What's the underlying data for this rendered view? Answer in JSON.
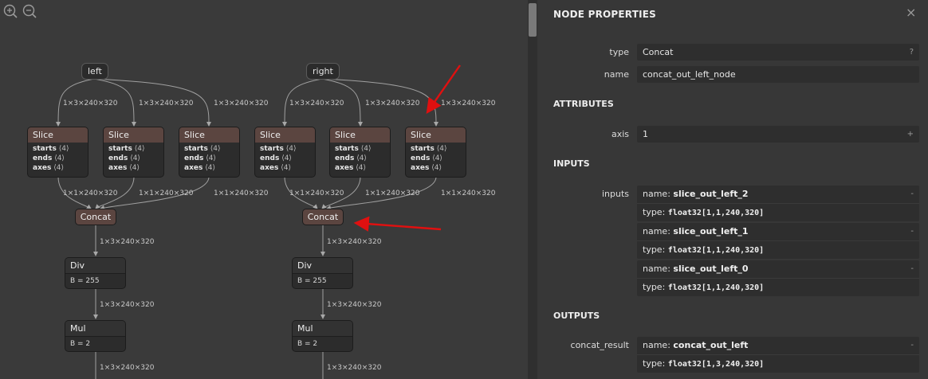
{
  "graph": {
    "edge_labels": {
      "rgb": "1×3×240×320",
      "channel": "1×1×240×320"
    },
    "inputs": {
      "left": "left",
      "right": "right"
    },
    "slice": {
      "title": "Slice",
      "attrs": [
        {
          "name": "starts",
          "value": "⟨4⟩"
        },
        {
          "name": "ends",
          "value": "⟨4⟩"
        },
        {
          "name": "axes",
          "value": "⟨4⟩"
        }
      ]
    },
    "concat_title": "Concat",
    "div": {
      "title": "Div",
      "attr": "B = 255"
    },
    "mul": {
      "title": "Mul",
      "attr": "B = 2"
    }
  },
  "panel": {
    "title": "NODE PROPERTIES",
    "close_icon": "×",
    "type_label": "type",
    "type_value": "Concat",
    "type_help": "?",
    "name_label": "name",
    "name_value": "concat_out_left_node",
    "attributes_header": "ATTRIBUTES",
    "axis_label": "axis",
    "axis_value": "1",
    "axis_btn": "+",
    "inputs_header": "INPUTS",
    "inputs_label": "inputs",
    "inputs": [
      {
        "name_prefix": "name: ",
        "name": "slice_out_left_2",
        "type_prefix": "type: ",
        "type": "float32[1,1,240,320]",
        "btn": "-"
      },
      {
        "name_prefix": "name: ",
        "name": "slice_out_left_1",
        "type_prefix": "type: ",
        "type": "float32[1,1,240,320]",
        "btn": "-"
      },
      {
        "name_prefix": "name: ",
        "name": "slice_out_left_0",
        "type_prefix": "type: ",
        "type": "float32[1,1,240,320]",
        "btn": "-"
      }
    ],
    "outputs_header": "OUTPUTS",
    "output_label": "concat_result",
    "output": {
      "name_prefix": "name: ",
      "name": "concat_out_left",
      "type_prefix": "type: ",
      "type": "float32[1,3,240,320]",
      "btn": "-"
    }
  },
  "colors": {
    "canvas": "#3a3a3a",
    "panel": "#373737",
    "slice_header": "#5b4540",
    "annotation_arrow": "#e01010"
  }
}
